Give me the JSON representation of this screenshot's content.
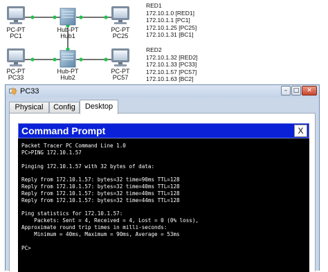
{
  "topology": {
    "devices": {
      "pc1": "PC-PT\nPC1",
      "hub1": "Hub-PT\nHub1",
      "pc25": "PC-PT\nPC25",
      "pc33": "PC-PT\nPC33",
      "hub2": "Hub-PT\nHub2",
      "pc57": "PC-PT\nPC57"
    },
    "red1": {
      "title": "RED1",
      "lines": [
        "172.10.1.0 [RED1]",
        "172.10.1.1 [PC1]",
        "172.10.1.25 [PC25]",
        "172.10.1.31 [BC1]"
      ]
    },
    "red2": {
      "title": "RED2",
      "lines": [
        "172.10.1.32 [RED2]",
        "172.10.1.33 [PC33]",
        "172.10.1.57 [PC57]",
        "172.10.1.63 [BC2]"
      ]
    },
    "link_color": "#1f1f1f",
    "link_light_color": "#22c24a"
  },
  "window": {
    "title": "PC33",
    "minimize_glyph": "–",
    "maximize_glyph": "□",
    "close_glyph": "✕",
    "tabs": [
      "Physical",
      "Config",
      "Desktop"
    ],
    "active_tab": "Desktop"
  },
  "command_prompt": {
    "title": "Command Prompt",
    "close_glyph": "X",
    "header_color": "#0a21d8",
    "lines": [
      "Packet Tracer PC Command Line 1.0",
      "PC>PING 172.10.1.57",
      "",
      "Pinging 172.10.1.57 with 32 bytes of data:",
      "",
      "Reply from 172.10.1.57: bytes=32 time=90ms TTL=128",
      "Reply from 172.10.1.57: bytes=32 time=40ms TTL=128",
      "Reply from 172.10.1.57: bytes=32 time=40ms TTL=128",
      "Reply from 172.10.1.57: bytes=32 time=44ms TTL=128",
      "",
      "Ping statistics for 172.10.1.57:",
      "    Packets: Sent = 4, Received = 4, Lost = 0 (0% loss),",
      "Approximate round trip times in milli-seconds:",
      "    Minimum = 40ms, Maximum = 90ms, Average = 53ms",
      "",
      "PC>"
    ]
  }
}
